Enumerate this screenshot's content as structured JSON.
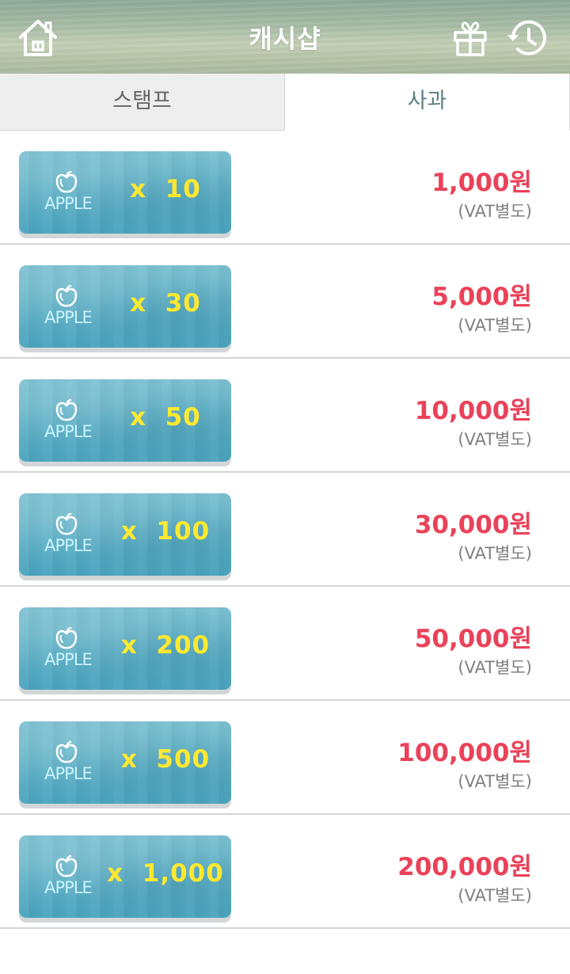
{
  "header": {
    "title": "캐시샵",
    "home_icon": "home-icon",
    "gift_icon": "gift-icon",
    "history_icon": "history-icon"
  },
  "tabs": [
    {
      "label": "스탬프",
      "active": false
    },
    {
      "label": "사과",
      "active": true
    }
  ],
  "colors": {
    "price": "#ea4259",
    "quantity": "#ffe930",
    "button": "#5fb0c6",
    "apple_label": "#c8f4ff"
  },
  "items": [
    {
      "icon": "apple-icon",
      "label": "APPLE",
      "quantity": "x  10",
      "price": "1,000원",
      "vat": "(VAT별도)"
    },
    {
      "icon": "apple-icon",
      "label": "APPLE",
      "quantity": "x  30",
      "price": "5,000원",
      "vat": "(VAT별도)"
    },
    {
      "icon": "apple-icon",
      "label": "APPLE",
      "quantity": "x  50",
      "price": "10,000원",
      "vat": "(VAT별도)"
    },
    {
      "icon": "apple-icon",
      "label": "APPLE",
      "quantity": "x  100",
      "price": "30,000원",
      "vat": "(VAT별도)"
    },
    {
      "icon": "apple-icon",
      "label": "APPLE",
      "quantity": "x  200",
      "price": "50,000원",
      "vat": "(VAT별도)"
    },
    {
      "icon": "apple-icon",
      "label": "APPLE",
      "quantity": "x  500",
      "price": "100,000원",
      "vat": "(VAT별도)"
    },
    {
      "icon": "apple-icon",
      "label": "APPLE",
      "quantity": "x  1,000",
      "price": "200,000원",
      "vat": "(VAT별도)"
    }
  ]
}
